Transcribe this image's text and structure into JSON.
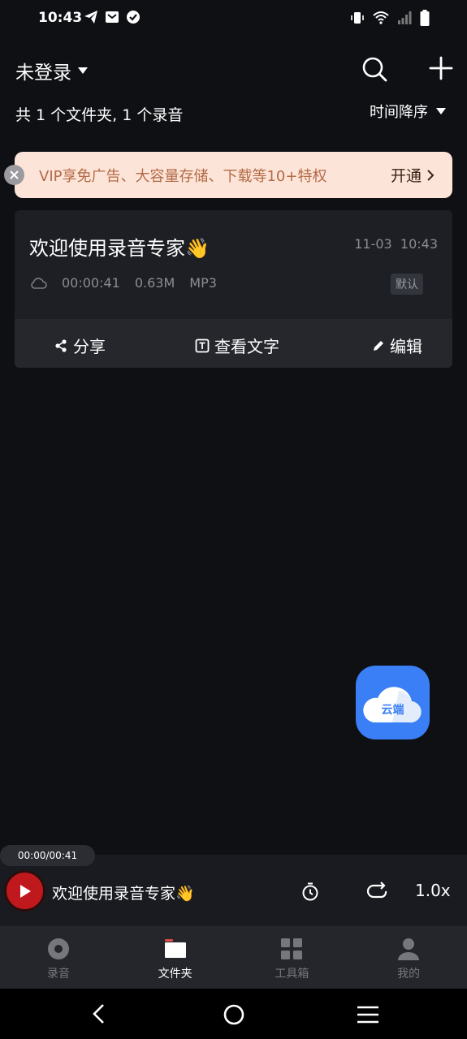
{
  "status_bar": {
    "time": "10:43"
  },
  "header": {
    "account_label": "未登录",
    "summary": "共 1 个文件夹, 1 个录音",
    "sort_label": "时间降序"
  },
  "vip_banner": {
    "text": "VIP享免广告、大容量存储、下载等10+特权",
    "action": "开通"
  },
  "recording": {
    "title": "欢迎使用录音专家👋",
    "date": "11-03",
    "time": "10:43",
    "duration": "00:00:41",
    "size": "0.63M",
    "format": "MP3",
    "tag": "默认",
    "actions": {
      "share": "分享",
      "view_text": "查看文字",
      "edit": "编辑"
    }
  },
  "cloud_fab": {
    "label": "云端"
  },
  "player": {
    "progress": "00:00/00:41",
    "title": "欢迎使用录音专家👋",
    "speed": "1.0x"
  },
  "bottom_nav": [
    {
      "label": "录音",
      "icon": "record-icon",
      "active": false
    },
    {
      "label": "文件夹",
      "icon": "folder-icon",
      "active": true
    },
    {
      "label": "工具箱",
      "icon": "toolbox-icon",
      "active": false
    },
    {
      "label": "我的",
      "icon": "profile-icon",
      "active": false
    }
  ],
  "colors": {
    "accent_red": "#c0191d",
    "fab_blue": "#3a7ff5",
    "vip_bg": "#fde4d8",
    "vip_text": "#b26a46"
  }
}
